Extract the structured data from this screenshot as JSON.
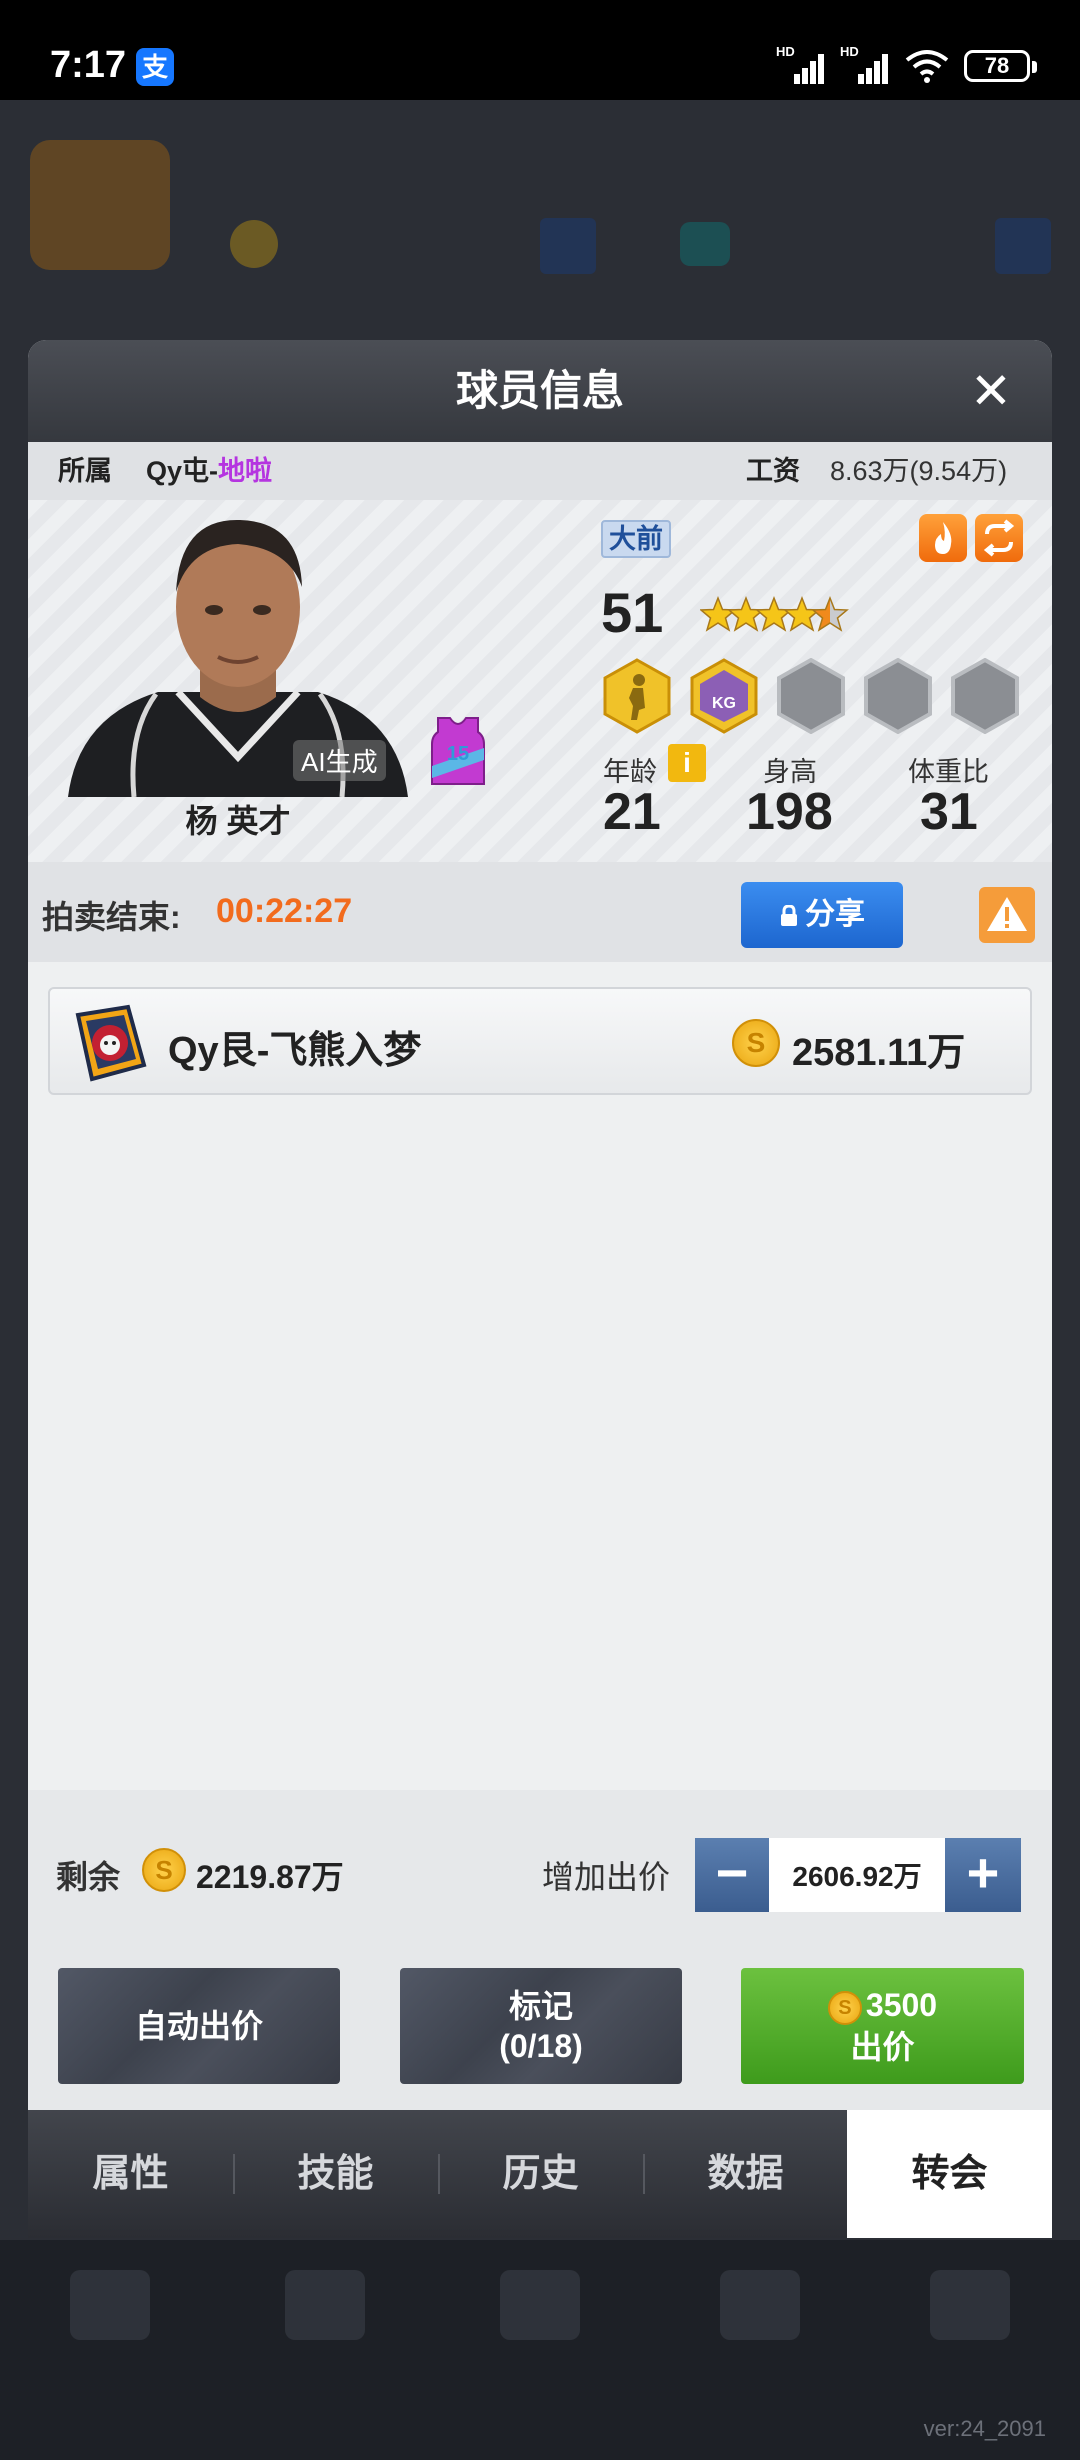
{
  "status_bar": {
    "time": "7:17",
    "alipay_icon_glyph": "支",
    "signal_1_label": "HD",
    "signal_2_label": "HD",
    "battery": "78"
  },
  "background_app": {
    "version": "ver:24_2091"
  },
  "modal": {
    "title": "球员信息",
    "close_glyph": "✕",
    "affiliation_label": "所属",
    "team_prefix": "Qy屯-",
    "team_highlight": "地啦",
    "salary_label": "工资",
    "salary_value": "8.63万(9.54万)"
  },
  "player": {
    "name": "杨 英才",
    "ai_tag": "AI生成",
    "jersey_number": "15",
    "position": "大前",
    "rating": "51",
    "stars": 4.5,
    "skill_badges": [
      {
        "icon": "silhouette-badge-icon",
        "active": true
      },
      {
        "icon": "kg-badge-icon",
        "label": "KG",
        "active": true
      },
      {
        "icon": "empty-hex-badge-icon",
        "active": false
      },
      {
        "icon": "empty-hex-badge-icon",
        "active": false
      },
      {
        "icon": "empty-hex-badge-icon",
        "active": false
      }
    ],
    "age_label": "年龄",
    "age": "21",
    "height_label": "身高",
    "height": "198",
    "weight_ratio_label": "体重比",
    "weight_ratio": "31"
  },
  "auction": {
    "end_label": "拍卖结束:",
    "countdown": "00:22:27",
    "share_label": "分享"
  },
  "bids": [
    {
      "team": "Qy艮-飞熊入梦",
      "amount": "2581.11万"
    }
  ],
  "bid_controls": {
    "remaining_label": "剩余",
    "remaining_value": "2219.87万",
    "increase_label": "增加出价",
    "increase_value": "2606.92万",
    "auto_bid_label": "自动出价",
    "mark_label": "标记",
    "mark_count": "(0/18)",
    "bid_amount": "3500",
    "bid_label": "出价"
  },
  "tabs": [
    {
      "label": "属性",
      "active": false
    },
    {
      "label": "技能",
      "active": false
    },
    {
      "label": "历史",
      "active": false
    },
    {
      "label": "数据",
      "active": false
    },
    {
      "label": "转会",
      "active": true
    }
  ],
  "colors": {
    "accent_orange": "#f26b1d",
    "team_highlight": "#b535e0",
    "share_blue": "#1d66cf",
    "bid_green": "#3e9b1c",
    "tab_active_bg": "#ffffff"
  }
}
